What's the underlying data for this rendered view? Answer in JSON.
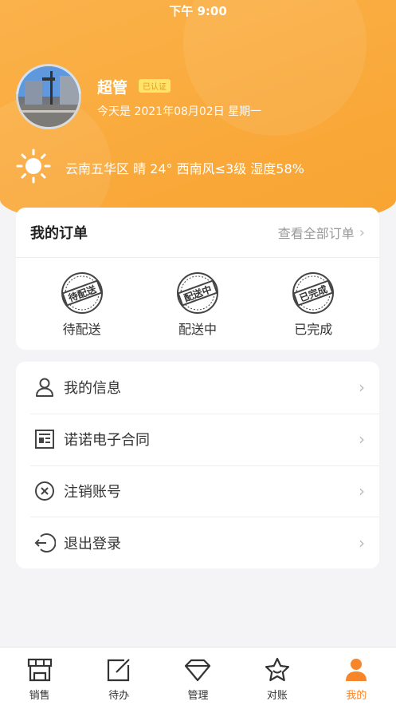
{
  "status_bar": {
    "time": "下午 9:00"
  },
  "profile": {
    "name": "超管",
    "badge": "已认证",
    "date": "今天是 2021年08月02日 星期一"
  },
  "weather": {
    "text": "云南五华区 晴 24° 西南风≤3级 湿度58%"
  },
  "orders": {
    "title": "我的订单",
    "view_all": "查看全部订单",
    "items": [
      {
        "label": "待配送",
        "stamp": "待配送"
      },
      {
        "label": "配送中",
        "stamp": "配送中"
      },
      {
        "label": "已完成",
        "stamp": "已完成"
      }
    ]
  },
  "menu": {
    "items": [
      {
        "label": "我的信息",
        "icon": "user-icon"
      },
      {
        "label": "诺诺电子合同",
        "icon": "contract-icon"
      },
      {
        "label": "注销账号",
        "icon": "cancel-circle-icon"
      },
      {
        "label": "退出登录",
        "icon": "logout-icon"
      }
    ]
  },
  "tabbar": {
    "items": [
      {
        "label": "销售",
        "icon": "store-icon"
      },
      {
        "label": "待办",
        "icon": "edit-icon"
      },
      {
        "label": "管理",
        "icon": "diamond-icon"
      },
      {
        "label": "对账",
        "icon": "star-icon"
      },
      {
        "label": "我的",
        "icon": "person-icon"
      }
    ],
    "active": "我的"
  },
  "colors": {
    "accent": "#f7862a",
    "header": "#f9a93a",
    "badge_bg": "#ffe36a"
  }
}
